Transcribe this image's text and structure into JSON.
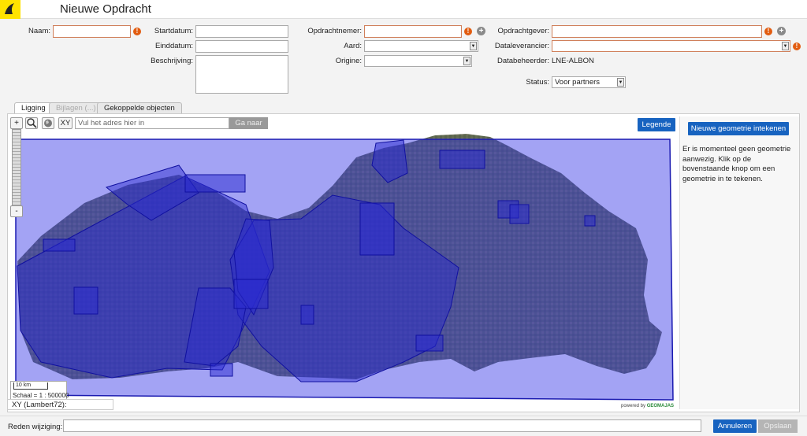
{
  "app": {
    "title": "Nieuwe Opdracht"
  },
  "form": {
    "naam_label": "Naam:",
    "startdatum_label": "Startdatum:",
    "einddatum_label": "Einddatum:",
    "beschrijving_label": "Beschrijving:",
    "opdrachtnemer_label": "Opdrachtnemer:",
    "aard_label": "Aard:",
    "origine_label": "Origine:",
    "opdrachtgever_label": "Opdrachtgever:",
    "dataleverancier_label": "Dataleverancier:",
    "databeheerder_label": "Databeheerder:",
    "databeheerder_value": "LNE-ALBON",
    "status_label": "Status:",
    "status_value": "Voor partners",
    "warn_symbol": "!",
    "plus_symbol": "+"
  },
  "tabs": [
    {
      "label": "Ligging",
      "state": "active"
    },
    {
      "label": "Bijlagen (...)",
      "state": "disabled"
    },
    {
      "label": "Gekoppelde objecten",
      "state": "normal"
    }
  ],
  "map": {
    "zoom_in": "+",
    "zoom_out": "-",
    "xy_button": "XY",
    "search_placeholder": "Vul het adres hier in",
    "go_button": "Ga naar",
    "legend_button": "Legende",
    "scale_bar": "10 km",
    "scale_text": "Schaal = 1 : 500000",
    "coords_label": "XY (Lambert72):",
    "powered_by": "powered by",
    "powered_brand": "GEOMAJAS"
  },
  "side": {
    "new_geometry_button": "Nieuwe geometrie intekenen",
    "message": "Er is momenteel geen geometrie aanwezig. Klik op de bovenstaande knop om een geometrie in te tekenen."
  },
  "footer": {
    "reason_label": "Reden wijziging:",
    "cancel_button": "Annuleren",
    "save_button": "Opslaan"
  },
  "colors": {
    "accent": "#1763c0",
    "warn": "#e25c10",
    "overlay": "#3232e6",
    "logo": "#ffe300"
  }
}
